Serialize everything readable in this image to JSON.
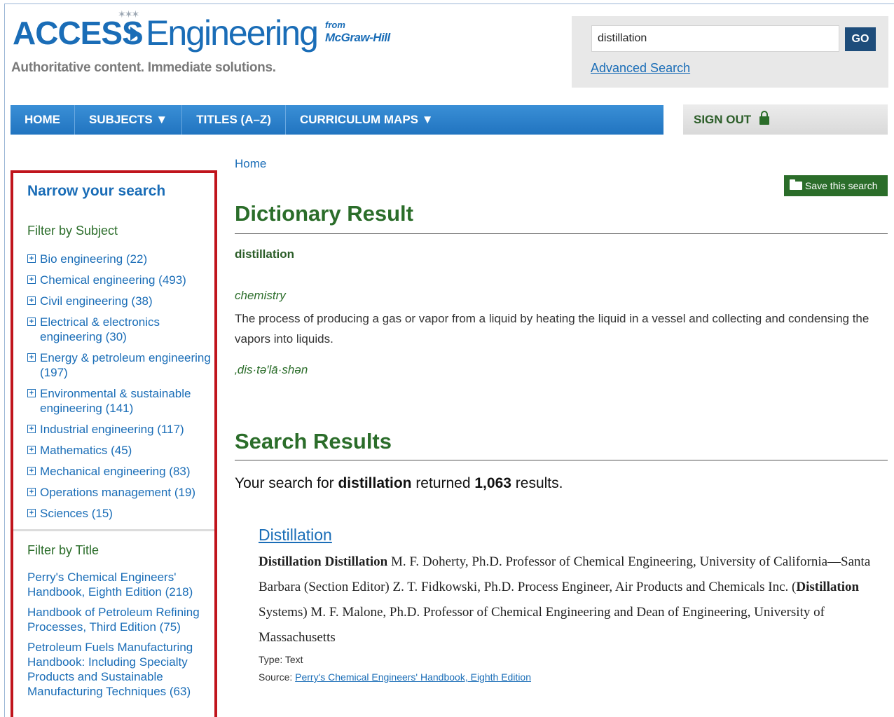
{
  "header": {
    "logo_access": "ACCESS",
    "logo_engineering": "Engineering",
    "logo_from": "from",
    "logo_publisher": "McGraw-Hill",
    "tagline": "Authoritative content. Immediate solutions."
  },
  "search": {
    "value": "distillation",
    "go_label": "GO",
    "advanced_label": "Advanced Search"
  },
  "nav": {
    "items": [
      {
        "label": "HOME"
      },
      {
        "label": "SUBJECTS ▼"
      },
      {
        "label": "TITLES (A–Z)"
      },
      {
        "label": "CURRICULUM MAPS ▼"
      }
    ],
    "signout_label": "SIGN OUT"
  },
  "sidebar": {
    "title": "Narrow your search",
    "subject_heading": "Filter by Subject",
    "subjects": [
      {
        "label": "Bio engineering (22)"
      },
      {
        "label": "Chemical engineering (493)"
      },
      {
        "label": "Civil engineering (38)"
      },
      {
        "label": "Electrical & electronics engineering (30)"
      },
      {
        "label": "Energy & petroleum engineering (197)"
      },
      {
        "label": "Environmental & sustainable engineering (141)"
      },
      {
        "label": "Industrial engineering (117)"
      },
      {
        "label": "Mathematics (45)"
      },
      {
        "label": "Mechanical engineering (83)"
      },
      {
        "label": "Operations management (19)"
      },
      {
        "label": "Sciences (15)"
      }
    ],
    "title_heading": "Filter by Title",
    "titles": [
      {
        "label": "Perry's Chemical Engineers' Handbook, Eighth Edition (218)"
      },
      {
        "label": "Handbook of Petroleum Refining Processes, Third Edition (75)"
      },
      {
        "label": "Petroleum Fuels Manufacturing Handbook: Including Specialty Products and Sustainable Manufacturing Techniques (63)"
      }
    ]
  },
  "main": {
    "breadcrumb": "Home",
    "save_label": "Save this search",
    "dictionary_heading": "Dictionary Result",
    "dict_term": "distillation",
    "dict_field": "chemistry",
    "dict_definition": "The process of producing a gas or vapor from a liquid by heating the liquid in a vessel and collecting and condensing the vapors into liquids.",
    "dict_pronunciation": "‚dis·tə′lā·shən",
    "results_heading": "Search Results",
    "summary_prefix": "Your search for ",
    "summary_query": "distillation",
    "summary_middle": " returned ",
    "summary_count": "1,063",
    "summary_suffix": " results.",
    "result": {
      "title": "Distillation",
      "snippet_b1": "Distillation Distillation",
      "snippet_t1": " M. F. Doherty, Ph.D. Professor of Chemical Engineering, University of California—Santa Barbara (Section Editor) Z. T. Fidkowski, Ph.D. Process Engineer, Air Products and Chemicals Inc. (",
      "snippet_b2": "Distillation",
      "snippet_t2": " Systems) M. F. Malone, Ph.D. Professor of Chemical Engineering and Dean of Engineering, University of Massachusetts",
      "type_label": "Type: ",
      "type_value": "Text",
      "source_label": "Source: ",
      "source_value": "Perry's Chemical Engineers' Handbook, Eighth Edition"
    }
  }
}
